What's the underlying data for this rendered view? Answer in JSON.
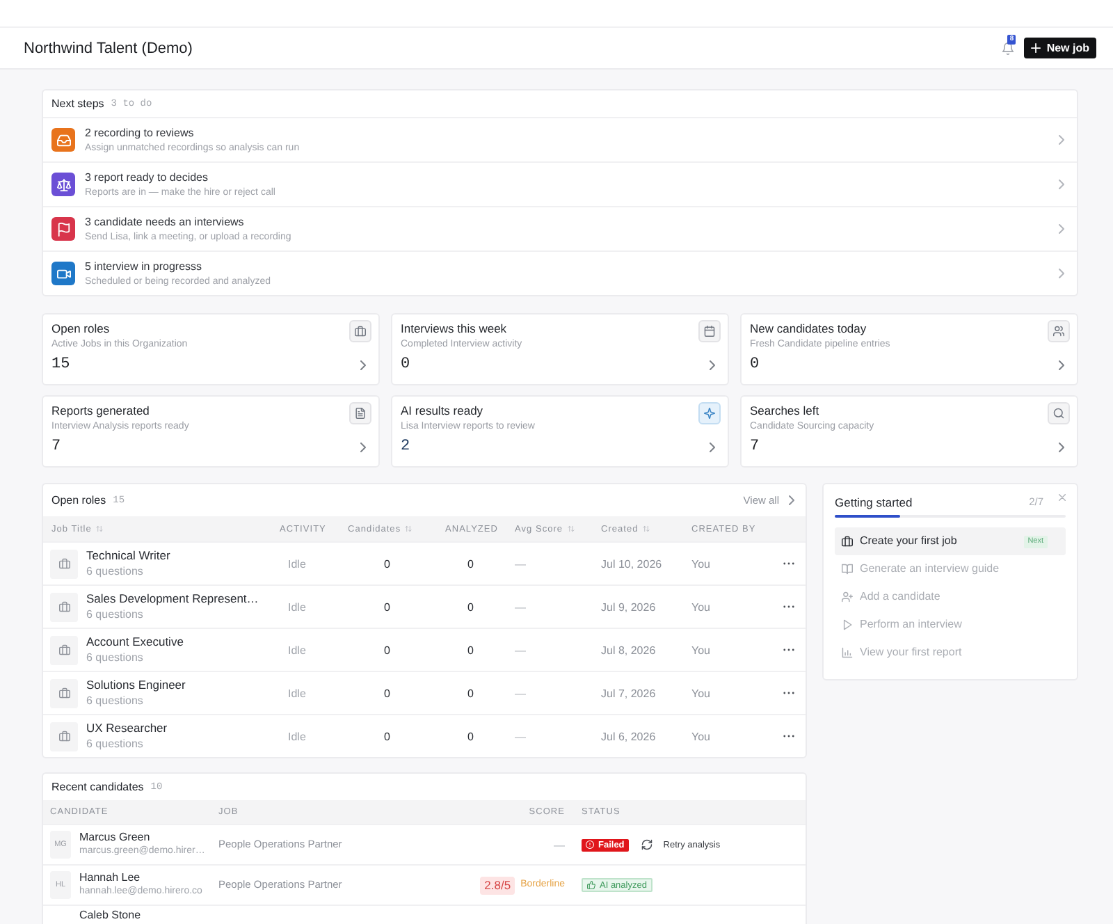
{
  "header": {
    "title": "Northwind Talent (Demo)",
    "notification_count": "8",
    "primary_button": "New job"
  },
  "next_steps": {
    "title": "Next steps",
    "count": "3 to do",
    "items": [
      {
        "kind": "inbox",
        "color": "#e8731c",
        "title": "2 recording to reviews",
        "description": "Assign unmatched recordings so analysis can run"
      },
      {
        "kind": "scale",
        "color": "#6b4fd6",
        "title": "3 report ready to decides",
        "description": "Reports are in — make the hire or reject call"
      },
      {
        "kind": "flag",
        "color": "#d8354b",
        "title": "3 candidate needs an interviews",
        "description": "Send Lisa, link a meeting, or upload a recording"
      },
      {
        "kind": "video",
        "color": "#1f78c8",
        "title": "5 interview in progresss",
        "description": "Scheduled or being recorded and analyzed"
      }
    ]
  },
  "stats": [
    {
      "kind": "briefcase",
      "title": "Open roles",
      "description": "Active Jobs in this Organization",
      "value": "15",
      "highlighted": false
    },
    {
      "kind": "calendar",
      "title": "Interviews this week",
      "description": "Completed Interview activity",
      "value": "0",
      "highlighted": false
    },
    {
      "kind": "users",
      "title": "New candidates today",
      "description": "Fresh Candidate pipeline entries",
      "value": "0",
      "highlighted": false
    },
    {
      "kind": "document",
      "title": "Reports generated",
      "description": "Interview Analysis reports ready",
      "value": "7",
      "highlighted": false
    },
    {
      "kind": "sparkle",
      "title": "AI results ready",
      "description": "Lisa Interview reports to review",
      "value": "2",
      "highlighted": true
    },
    {
      "kind": "search",
      "title": "Searches left",
      "description": "Candidate Sourcing capacity",
      "value": "7",
      "highlighted": false
    }
  ],
  "open_roles": {
    "title": "Open roles",
    "count": "15",
    "view_all": "View all",
    "columns": [
      {
        "label": "Job Title",
        "sortable": true
      },
      {
        "label": "ACTIVITY",
        "sortable": false
      },
      {
        "label": "Candidates",
        "sortable": true
      },
      {
        "label": "ANALYZED",
        "sortable": false
      },
      {
        "label": "Avg Score",
        "sortable": true
      },
      {
        "label": "Created",
        "sortable": true
      },
      {
        "label": "CREATED BY",
        "sortable": false
      }
    ],
    "rows": [
      {
        "title": "Technical Writer",
        "subtitle": "6 questions",
        "activity": "Idle",
        "candidates": "0",
        "analyzed": "0",
        "avg_score": "—",
        "created": "Jul 10, 2026",
        "created_by": "You"
      },
      {
        "title": "Sales Development Represent…",
        "subtitle": "6 questions",
        "activity": "Idle",
        "candidates": "0",
        "analyzed": "0",
        "avg_score": "—",
        "created": "Jul 9, 2026",
        "created_by": "You"
      },
      {
        "title": "Account Executive",
        "subtitle": "6 questions",
        "activity": "Idle",
        "candidates": "0",
        "analyzed": "0",
        "avg_score": "—",
        "created": "Jul 8, 2026",
        "created_by": "You"
      },
      {
        "title": "Solutions Engineer",
        "subtitle": "6 questions",
        "activity": "Idle",
        "candidates": "0",
        "analyzed": "0",
        "avg_score": "—",
        "created": "Jul 7, 2026",
        "created_by": "You"
      },
      {
        "title": "UX Researcher",
        "subtitle": "6 questions",
        "activity": "Idle",
        "candidates": "0",
        "analyzed": "0",
        "avg_score": "—",
        "created": "Jul 6, 2026",
        "created_by": "You"
      }
    ]
  },
  "getting_started": {
    "title": "Getting started",
    "progress": "2/7",
    "level": 0.2857,
    "items": [
      {
        "kind": "briefcase",
        "label": "Create your first job",
        "selected": true,
        "badge": "Next"
      },
      {
        "kind": "book",
        "label": "Generate an interview guide",
        "selected": false
      },
      {
        "kind": "user-plus",
        "label": "Add a candidate",
        "selected": false
      },
      {
        "kind": "play",
        "label": "Perform an interview",
        "selected": false
      },
      {
        "kind": "chart",
        "label": "View your first report",
        "selected": false
      }
    ]
  },
  "recent_candidates": {
    "title": "Recent candidates",
    "count": "10",
    "columns": [
      {
        "label": "CANDIDATE"
      },
      {
        "label": "JOB"
      },
      {
        "label": "SCORE"
      },
      {
        "label": "STATUS"
      }
    ],
    "rows": [
      {
        "initials": "MG",
        "name": "Marcus Green",
        "email": "marcus.green@demo.hirer…",
        "job": "People Operations Partner",
        "score": {
          "kind": "empty",
          "value": "—"
        },
        "status": {
          "kind": "failed",
          "label": "Failed"
        },
        "action": "Retry analysis"
      },
      {
        "initials": "HL",
        "name": "Hannah Lee",
        "email": "hannah.lee@demo.hirero.co",
        "job": "People Operations Partner",
        "score": {
          "kind": "low",
          "value": "2.8/5",
          "verdict": "Borderline"
        },
        "status": {
          "kind": "analyzed",
          "label": "AI analyzed"
        }
      },
      {
        "name": "Caleb Stone"
      }
    ]
  }
}
